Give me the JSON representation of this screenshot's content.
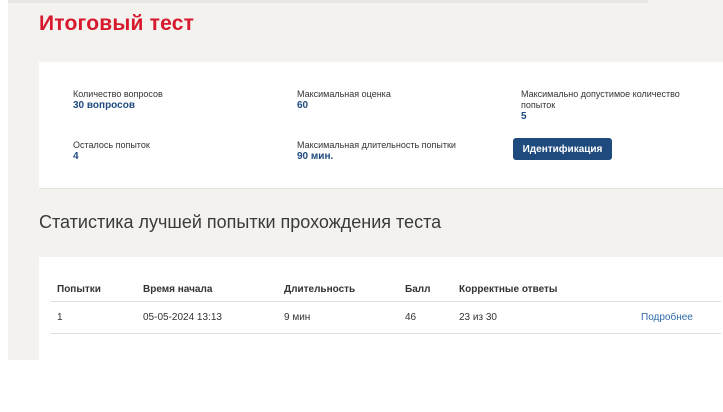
{
  "page": {
    "title": "Итоговый тест"
  },
  "info": {
    "questions_label": "Количество вопросов",
    "questions_value": "30 вопросов",
    "max_score_label": "Максимальная оценка",
    "max_score_value": "60",
    "max_attempts_label_line1": "Максимально допустимое количество",
    "max_attempts_label_line2": "попыток",
    "max_attempts_value": "5",
    "attempts_left_label": "Осталось попыток",
    "attempts_left_value": "4",
    "max_duration_label": "Максимальная длительность попытки",
    "max_duration_value": "90 мин.",
    "identification_button": "Идентификация"
  },
  "stats": {
    "title": "Статистика лучшей попытки прохождения теста",
    "columns": [
      "Попытки",
      "Время начала",
      "Длительность",
      "Балл",
      "Корректные ответы"
    ],
    "rows": [
      {
        "attempt": "1",
        "start_time": "05-05-2024 13:13",
        "duration": "9 мин",
        "score": "46",
        "correct": "23 из 30",
        "details_link": "Подробнее"
      }
    ]
  },
  "colors": {
    "title_red": "#d7192d",
    "value_blue": "#1f4a7e",
    "link_blue": "#2f6aa8",
    "page_bg": "#f3f2ef"
  }
}
